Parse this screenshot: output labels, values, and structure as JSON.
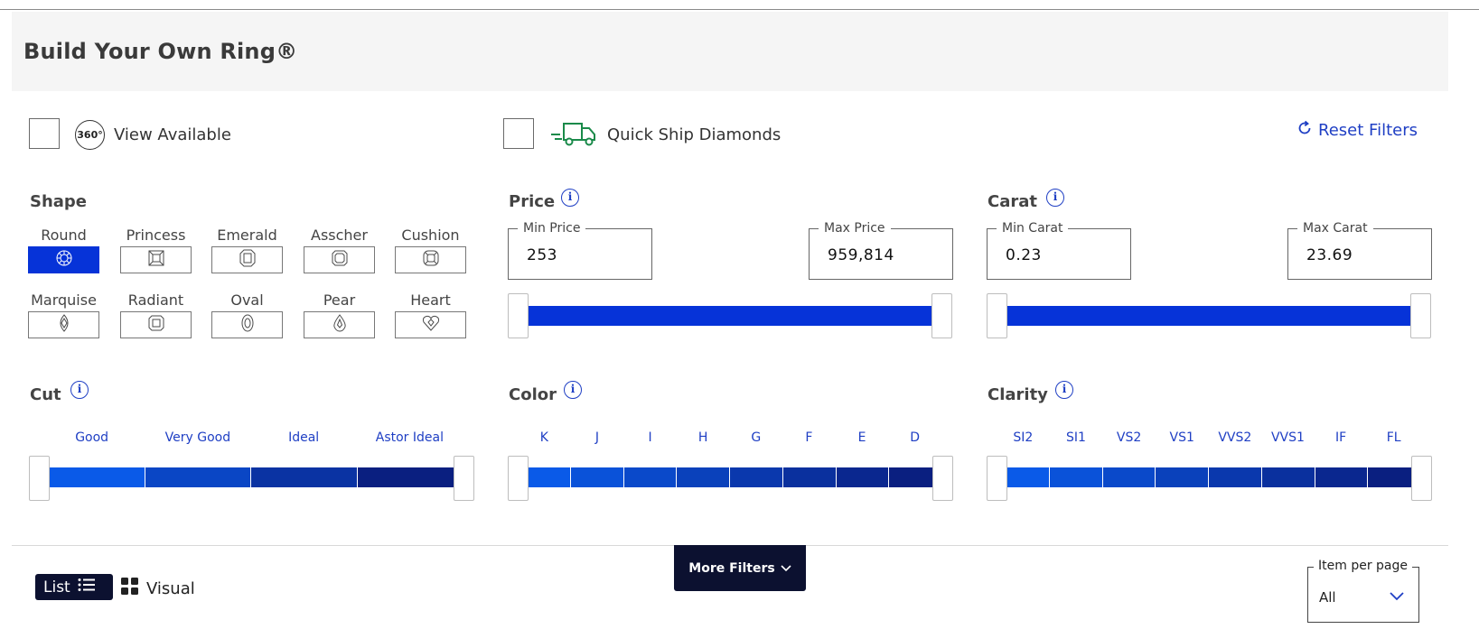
{
  "header": {
    "title": "Build Your Own Ring®"
  },
  "options": {
    "view_available": {
      "badge": "360°",
      "label": "View Available",
      "checked": false
    },
    "quick_ship": {
      "label": "Quick Ship Diamonds",
      "checked": false
    },
    "reset_label": "Reset Filters"
  },
  "shape": {
    "title": "Shape",
    "items": [
      {
        "label": "Round",
        "icon": "round-diamond-icon",
        "selected": true
      },
      {
        "label": "Princess",
        "icon": "princess-diamond-icon",
        "selected": false
      },
      {
        "label": "Emerald",
        "icon": "emerald-diamond-icon",
        "selected": false
      },
      {
        "label": "Asscher",
        "icon": "asscher-diamond-icon",
        "selected": false
      },
      {
        "label": "Cushion",
        "icon": "cushion-diamond-icon",
        "selected": false
      },
      {
        "label": "Marquise",
        "icon": "marquise-diamond-icon",
        "selected": false
      },
      {
        "label": "Radiant",
        "icon": "radiant-diamond-icon",
        "selected": false
      },
      {
        "label": "Oval",
        "icon": "oval-diamond-icon",
        "selected": false
      },
      {
        "label": "Pear",
        "icon": "pear-diamond-icon",
        "selected": false
      },
      {
        "label": "Heart",
        "icon": "heart-diamond-icon",
        "selected": false
      }
    ]
  },
  "price": {
    "title": "Price",
    "info": "i",
    "min_label": "Min Price",
    "min_value": "253",
    "max_label": "Max Price",
    "max_value": "959,814"
  },
  "carat": {
    "title": "Carat",
    "info": "i",
    "min_label": "Min Carat",
    "min_value": "0.23",
    "max_label": "Max Carat",
    "max_value": "23.69"
  },
  "cut": {
    "title": "Cut",
    "info": "i",
    "grades": [
      "Good",
      "Very Good",
      "Ideal",
      "Astor Ideal"
    ]
  },
  "color": {
    "title": "Color",
    "info": "i",
    "grades": [
      "K",
      "J",
      "I",
      "H",
      "G",
      "F",
      "E",
      "D"
    ]
  },
  "clarity": {
    "title": "Clarity",
    "info": "i",
    "grades": [
      "SI2",
      "SI1",
      "VS2",
      "VS1",
      "VVS2",
      "VVS1",
      "IF",
      "FL"
    ]
  },
  "footer": {
    "list_label": "List",
    "visual_label": "Visual",
    "more_filters_label": "More Filters",
    "per_page_label": "Item per page",
    "per_page_value": "All"
  },
  "colors": {
    "accent": "#0633d8",
    "link": "#1f3fc4",
    "dark": "#0c1130",
    "gradient_start": "#0a5ae8",
    "gradient_end": "#0a1f80"
  }
}
